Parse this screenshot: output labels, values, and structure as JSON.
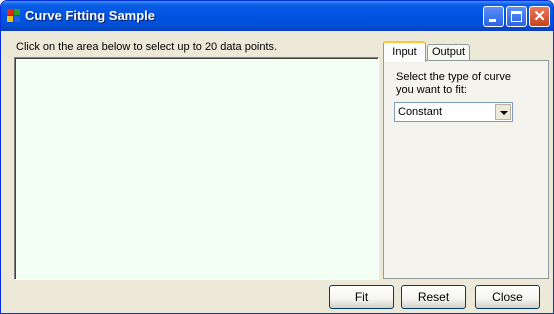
{
  "window": {
    "title": "Curve Fitting Sample",
    "icon": "app-icon",
    "controls": {
      "minimize": "minimize-icon",
      "maximize": "maximize-icon",
      "close": "close-icon",
      "close_glyph": "✕"
    }
  },
  "instruction": "Click on the area below to select up to 20 data points.",
  "tabs": [
    {
      "label": "Input",
      "selected": true
    },
    {
      "label": "Output",
      "selected": false
    }
  ],
  "input_panel": {
    "prompt": "Select the type of curve you want to fit:",
    "curve_type": {
      "selected": "Constant"
    }
  },
  "buttons": {
    "fit": "Fit",
    "reset": "Reset",
    "close": "Close"
  },
  "colors": {
    "titlebar": "#0054e3",
    "window_bg": "#ece9d8",
    "plot_area_bg": "#f3fff3",
    "tab_accent": "#ffc83c"
  }
}
